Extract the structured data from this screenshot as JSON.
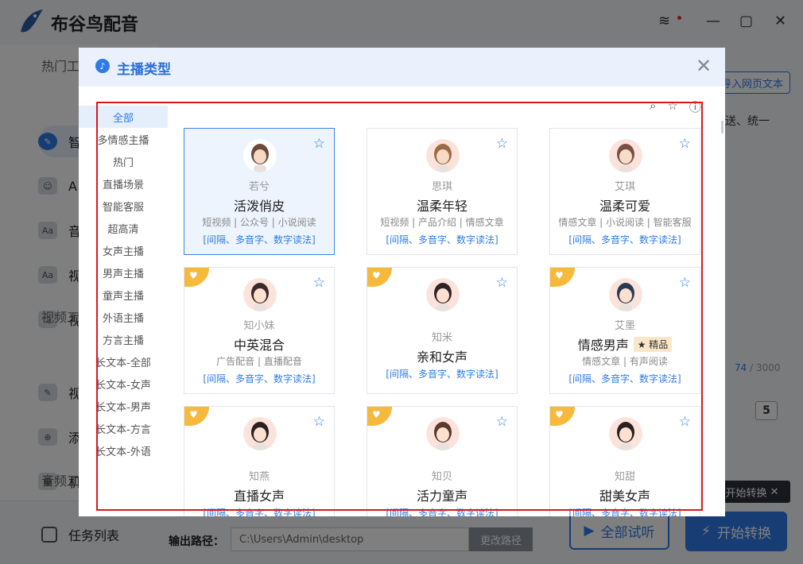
{
  "app": {
    "title": "布谷鸟配音"
  },
  "sidebar": {
    "section_hot": "热门工",
    "section_video": "视频工",
    "section_audio": "音频工",
    "items": [
      {
        "label": "智",
        "icon": "smart-icon"
      },
      {
        "label": "A",
        "icon": "ai-icon"
      },
      {
        "label": "音",
        "icon": "audio-icon"
      },
      {
        "label": "视",
        "icon": "video-icon"
      },
      {
        "label": "视",
        "icon": "video-voice-icon"
      },
      {
        "label": "视",
        "icon": "video-tool-icon"
      },
      {
        "label": "添",
        "icon": "add-icon"
      },
      {
        "label": "机",
        "icon": "robot-icon"
      }
    ],
    "task_list": "任务列表"
  },
  "right_panel": {
    "import_btn": "导入网页文本",
    "text_snippet": "送、统一",
    "char_count": "74",
    "char_total": "/ 3000",
    "speed_value": "5",
    "tooltip": "开始转换"
  },
  "output": {
    "label": "输出路径：",
    "path": "C:\\Users\\Admin\\desktop",
    "change_btn": "更改路径"
  },
  "actions": {
    "preview_all": "全部试听",
    "start_convert": "开始转换"
  },
  "modal": {
    "title": "主播类型",
    "categories": [
      "全部",
      "多情感主播",
      "热门",
      "直播场景",
      "智能客服",
      "超高清",
      "女声主播",
      "男声主播",
      "童声主播",
      "外语主播",
      "方言主播",
      "长文本-全部",
      "长文本-女声",
      "长文本-男声",
      "长文本-方言",
      "长文本-外语"
    ],
    "active_category_index": 0,
    "voices": [
      {
        "name": "若兮",
        "type": "活泼俏皮",
        "tags": "短视频 | 公众号 | 小说阅读",
        "links": "[间隔、多音字、数字读法]",
        "premium_badge": false,
        "selected": true,
        "face": "#f7d9c4",
        "hair": "#6b4a3a"
      },
      {
        "name": "思琪",
        "type": "温柔年轻",
        "tags": "短视频 | 产品介绍 | 情感文章",
        "links": "[间隔、多音字、数字读法]",
        "premium_badge": false,
        "selected": false,
        "face": "#f7d9c4",
        "hair": "#9c6b45"
      },
      {
        "name": "艾琪",
        "type": "温柔可爱",
        "tags": "情感文章 | 小说阅读 | 智能客服",
        "links": "[间隔、多音字、数字读法]",
        "premium_badge": false,
        "selected": false,
        "face": "#f7dcc9",
        "hair": "#7a5140"
      },
      {
        "name": "知小妹",
        "type": "中英混合",
        "tags": "广告配音 | 直播配音",
        "links": "[间隔、多音字、数字读法]",
        "premium_badge": true,
        "selected": false,
        "face": "#fde0d0",
        "hair": "#3a2a2a"
      },
      {
        "name": "知米",
        "type": "亲和女声",
        "tags": "",
        "links": "[间隔、多音字、数字读法]",
        "premium_badge": true,
        "selected": false,
        "face": "#fde0d0",
        "hair": "#2f2424"
      },
      {
        "name": "艾墨",
        "type": "情感男声",
        "tags": "情感文章 | 有声阅读",
        "links": "[间隔、多音字、数字读法]",
        "premium_badge": true,
        "selected": false,
        "quality_tag": "★ 精品",
        "face": "#fbe0cf",
        "hair": "#2a3a55"
      },
      {
        "name": "知燕",
        "type": "直播女声",
        "tags": "",
        "links": "[间隔、多音字、数字读法]",
        "premium_badge": true,
        "selected": false,
        "face": "#fde0d0",
        "hair": "#2a2020"
      },
      {
        "name": "知贝",
        "type": "活力童声",
        "tags": "",
        "links": "[间隔、多音字、数字读法]",
        "premium_badge": true,
        "selected": false,
        "face": "#fde0d0",
        "hair": "#5a3a2a"
      },
      {
        "name": "知甜",
        "type": "甜美女声",
        "tags": "",
        "links": "[间隔、多音字、数字读法]",
        "premium_badge": true,
        "selected": false,
        "face": "#fde0d0",
        "hair": "#2a2020"
      }
    ]
  },
  "colors": {
    "accent": "#2e7be8",
    "badge": "#f6b93b",
    "highlight_frame": "#d9191c"
  }
}
